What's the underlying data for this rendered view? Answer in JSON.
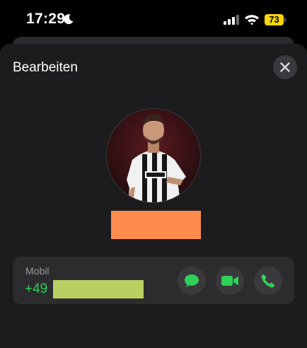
{
  "status_bar": {
    "time": "17:29",
    "battery_level": "73",
    "icons": [
      "moon-icon",
      "cellular-signal-icon",
      "wifi-icon",
      "battery-icon"
    ]
  },
  "sheet": {
    "title": "Bearbeiten",
    "close_icon": "close-icon"
  },
  "contact": {
    "photo": "avatar"
  },
  "phone_entry": {
    "label": "Mobil",
    "number_prefix": "+49",
    "actions": [
      "message-icon",
      "video-icon",
      "phone-icon"
    ]
  },
  "colors": {
    "accent_green": "#30d158",
    "name_redaction": "#fd8c4e",
    "number_redaction": "#b9cf62",
    "battery": "#ffd60a"
  }
}
